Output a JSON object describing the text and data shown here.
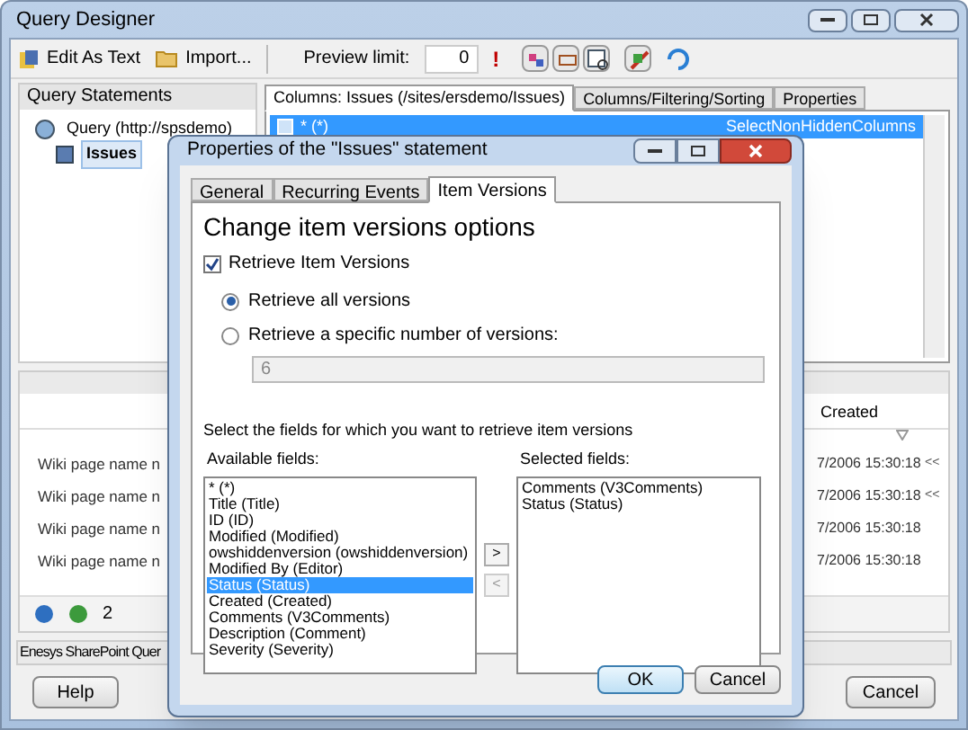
{
  "window": {
    "title": "Query Designer"
  },
  "toolbar": {
    "edit_as_text": "Edit As Text",
    "import": "Import...",
    "preview_label": "Preview limit:",
    "preview_value": "0",
    "alert": "!"
  },
  "query_statements": {
    "title": "Query Statements",
    "tree": [
      {
        "label": "Query (http://spsdemo)",
        "selected": false,
        "children": [
          {
            "label": "Issues",
            "selected": true
          }
        ]
      }
    ]
  },
  "main_tabs": [
    {
      "label": "Columns: Issues (/sites/ersdemo/Issues)",
      "selected": true
    },
    {
      "label": "Columns/Filtering/Sorting",
      "selected": false
    },
    {
      "label": "Properties",
      "selected": false
    }
  ],
  "columns_row": {
    "name": "* (*)",
    "value": "SelectNonHiddenColumns"
  },
  "grid": {
    "header": "Created",
    "rows": [
      {
        "title": "Wiki page name n",
        "created": "7/2006 15:30:18",
        "extra": "<<"
      },
      {
        "title": "Wiki page name n",
        "created": "7/2006 15:30:18",
        "extra": "<<"
      },
      {
        "title": "Wiki page name n",
        "created": "7/2006 15:30:18",
        "extra": ""
      },
      {
        "title": "Wiki page name n",
        "created": "7/2006 15:30:18",
        "extra": ""
      }
    ],
    "page": "2"
  },
  "status_bar": "Enesys SharePoint Quer",
  "buttons": {
    "help": "Help",
    "cancel": "Cancel"
  },
  "dialog": {
    "title": "Properties of the \"Issues\" statement",
    "tabs": [
      {
        "label": "General",
        "selected": false
      },
      {
        "label": "Recurring Events",
        "selected": false
      },
      {
        "label": "Item Versions",
        "selected": true
      }
    ],
    "heading": "Change item versions options",
    "retrieve_versions": {
      "label": "Retrieve Item Versions",
      "checked": true
    },
    "options": [
      {
        "label": "Retrieve all versions",
        "selected": true
      },
      {
        "label": "Retrieve a specific number of versions:",
        "selected": false
      }
    ],
    "count": "6",
    "instruction": "Select the fields for which you want to retrieve item versions",
    "available_label": "Available fields:",
    "available": [
      {
        "label": "* (*)",
        "selected": false
      },
      {
        "label": "Title (Title)",
        "selected": false
      },
      {
        "label": "ID (ID)",
        "selected": false
      },
      {
        "label": "Modified (Modified)",
        "selected": false
      },
      {
        "label": "owshiddenversion (owshiddenversion)",
        "selected": false
      },
      {
        "label": "Modified By (Editor)",
        "selected": false
      },
      {
        "label": "Status (Status)",
        "selected": true
      },
      {
        "label": "Created (Created)",
        "selected": false
      },
      {
        "label": "Comments (V3Comments)",
        "selected": false
      },
      {
        "label": "Description (Comment)",
        "selected": false
      },
      {
        "label": "Severity (Severity)",
        "selected": false
      }
    ],
    "add": ">",
    "remove": "<",
    "selected_label": "Selected fields:",
    "selected_fields": [
      "Comments (V3Comments)",
      "Status (Status)"
    ],
    "ok": "OK",
    "cancel": "Cancel"
  }
}
